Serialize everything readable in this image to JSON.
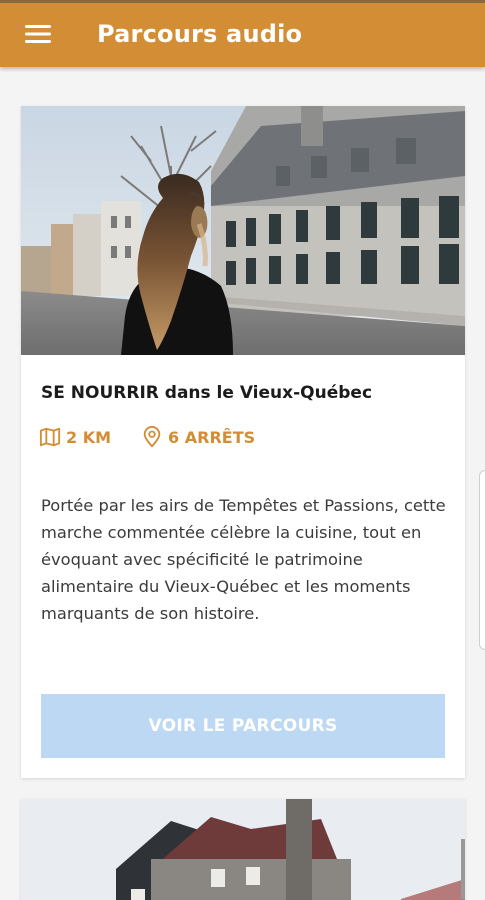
{
  "header": {
    "title": "Parcours audio",
    "menu_icon": "hamburger-menu-icon",
    "color": "#d38d34"
  },
  "cards": [
    {
      "title": "SE NOURRIR dans le Vieux-Québec",
      "distance": "2 KM",
      "distance_icon": "map-icon",
      "stops": "6 ARRÊTS",
      "stops_icon": "location-pin-icon",
      "description": "Portée par les airs de Tempêtes et Passions, cette marche commentée célèbre la cuisine, tout en évoquant avec spécificité le patrimoine alimentaire du Vieux-Québec et les moments marquants de son histoire.",
      "button_label": "VOIR LE PARCOURS",
      "accent": "#d38d34",
      "button_color": "#bcd8f2"
    }
  ]
}
